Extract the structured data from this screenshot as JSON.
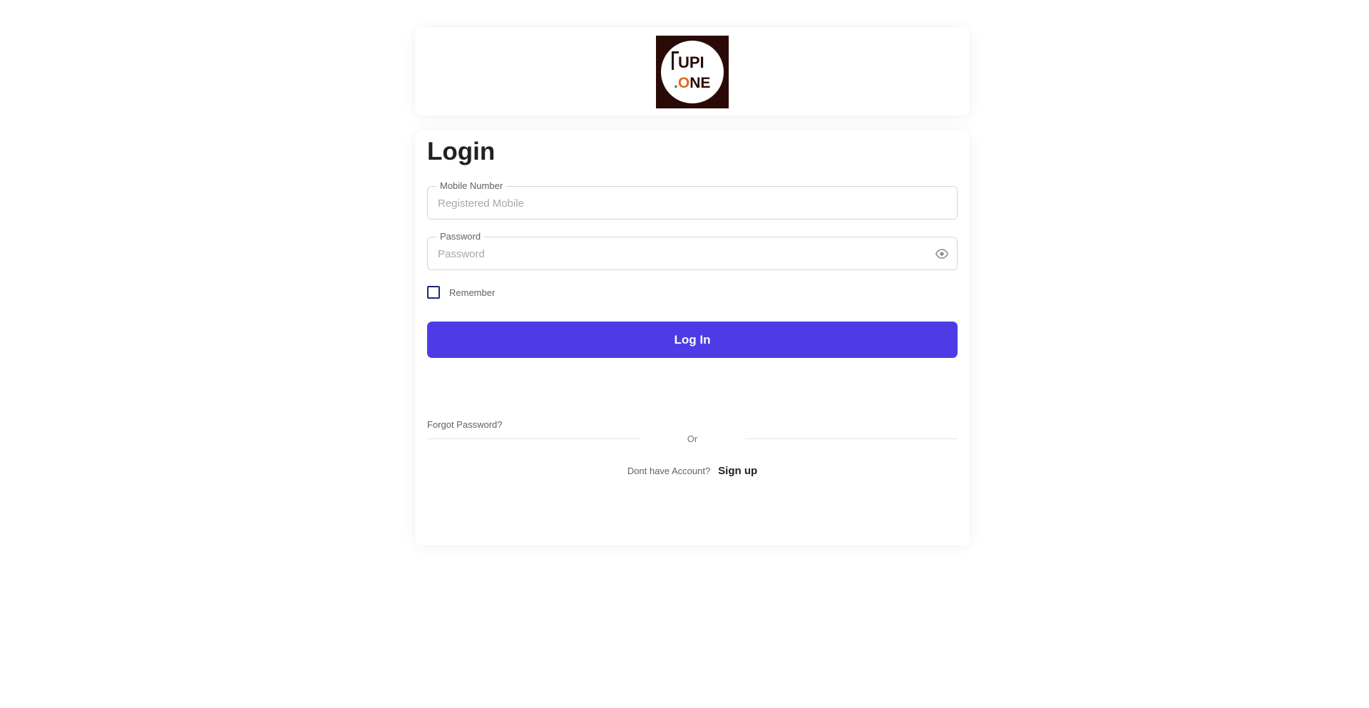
{
  "logo": {
    "top_text": "UPI",
    "bottom_dot": ".",
    "bottom_o": "O",
    "bottom_rest": "NE",
    "colors": {
      "background": "#2a0a06",
      "dot": "#2e7d32",
      "o": "#e06a1e"
    }
  },
  "form": {
    "title": "Login",
    "mobile": {
      "label": "Mobile Number",
      "placeholder": "Registered Mobile",
      "value": ""
    },
    "password": {
      "label": "Password",
      "placeholder": "Password",
      "value": "",
      "toggle_icon": "eye-icon"
    },
    "remember_label": "Remember",
    "remember_checked": false,
    "login_button": "Log In",
    "forgot_password": "Forgot Password?",
    "divider_text": "Or",
    "no_account_text": "Dont have Account?",
    "signup_link": "Sign up"
  },
  "colors": {
    "accent": "#4f3be6",
    "checkbox_border": "#1e2a78"
  }
}
